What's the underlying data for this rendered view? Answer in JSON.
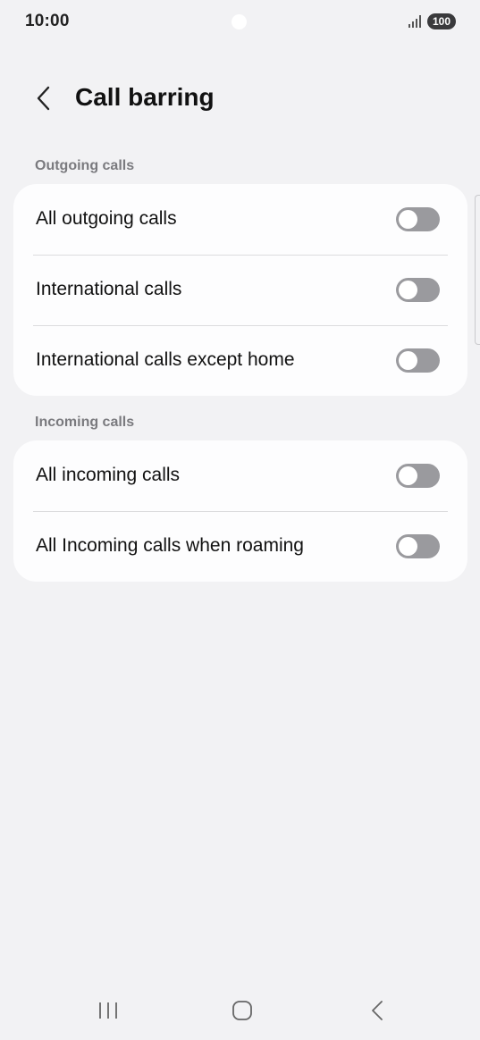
{
  "status_bar": {
    "time": "10:00",
    "battery": "100",
    "signal_icon": "signal-bars-icon"
  },
  "header": {
    "back_icon": "chevron-left-icon",
    "title": "Call barring"
  },
  "sections": [
    {
      "label": "Outgoing calls",
      "items": [
        {
          "label": "All outgoing calls",
          "on": false
        },
        {
          "label": "International calls",
          "on": false
        },
        {
          "label": "International calls except home",
          "on": false
        }
      ]
    },
    {
      "label": "Incoming calls",
      "items": [
        {
          "label": "All incoming calls",
          "on": false
        },
        {
          "label": "All Incoming calls when roaming",
          "on": false
        }
      ]
    }
  ],
  "nav_bar": {
    "recents_icon": "recents-icon",
    "home_icon": "home-icon",
    "back_icon": "back-icon"
  },
  "colors": {
    "background": "#f2f2f4",
    "card": "#fdfdfe",
    "toggle_off": "#9a9a9e",
    "section_label": "#7a7a7e"
  }
}
